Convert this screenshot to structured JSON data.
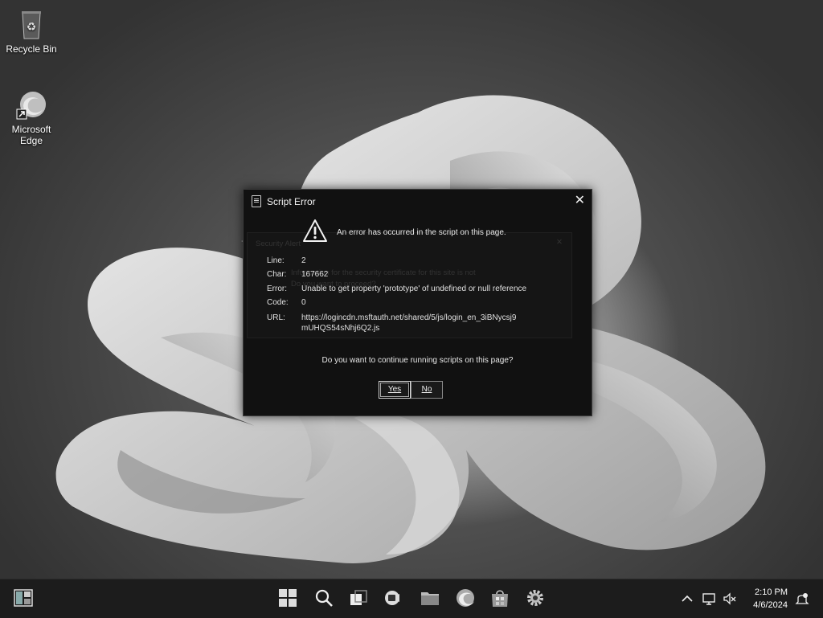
{
  "desktop": {
    "icons": [
      {
        "label": "Recycle Bin",
        "icon": "recycle-bin-icon"
      },
      {
        "label": "Microsoft Edge",
        "icon": "edge-icon"
      }
    ]
  },
  "dialog": {
    "title": "Script Error",
    "close_glyph": "✕",
    "headline": "An error has occurred in the script on this page.",
    "fields": {
      "line_label": "Line:",
      "line_value": "2",
      "char_label": "Char:",
      "char_value": "167662",
      "error_label": "Error:",
      "error_value": "Unable to get property 'prototype' of undefined or null reference",
      "code_label": "Code:",
      "code_value": "0",
      "url_label": "URL:",
      "url_value_1": "https://logincdn.msftauth.net/shared/5/js/login_en_3iBNycsj9",
      "url_value_2": "mUHQS54sNhj6Q2.js"
    },
    "background_dialog": {
      "title": "Security Alert",
      "text_1": "Information for the security certificate for this site is not",
      "text_2": "Do you want to proceed?"
    },
    "question": "Do you want to continue running scripts on this page?",
    "yes_label": "Yes",
    "no_label": "No"
  },
  "taskbar": {
    "items": [
      "widgets-icon",
      "start-icon",
      "search-icon",
      "task-view-icon",
      "meet-icon",
      "file-explorer-icon",
      "edge-icon",
      "store-icon",
      "settings-icon"
    ],
    "tray": [
      "chevron-up-icon",
      "network-icon",
      "volume-muted-icon",
      "notification-icon"
    ],
    "time": "2:10 PM",
    "date": "4/6/2024"
  }
}
